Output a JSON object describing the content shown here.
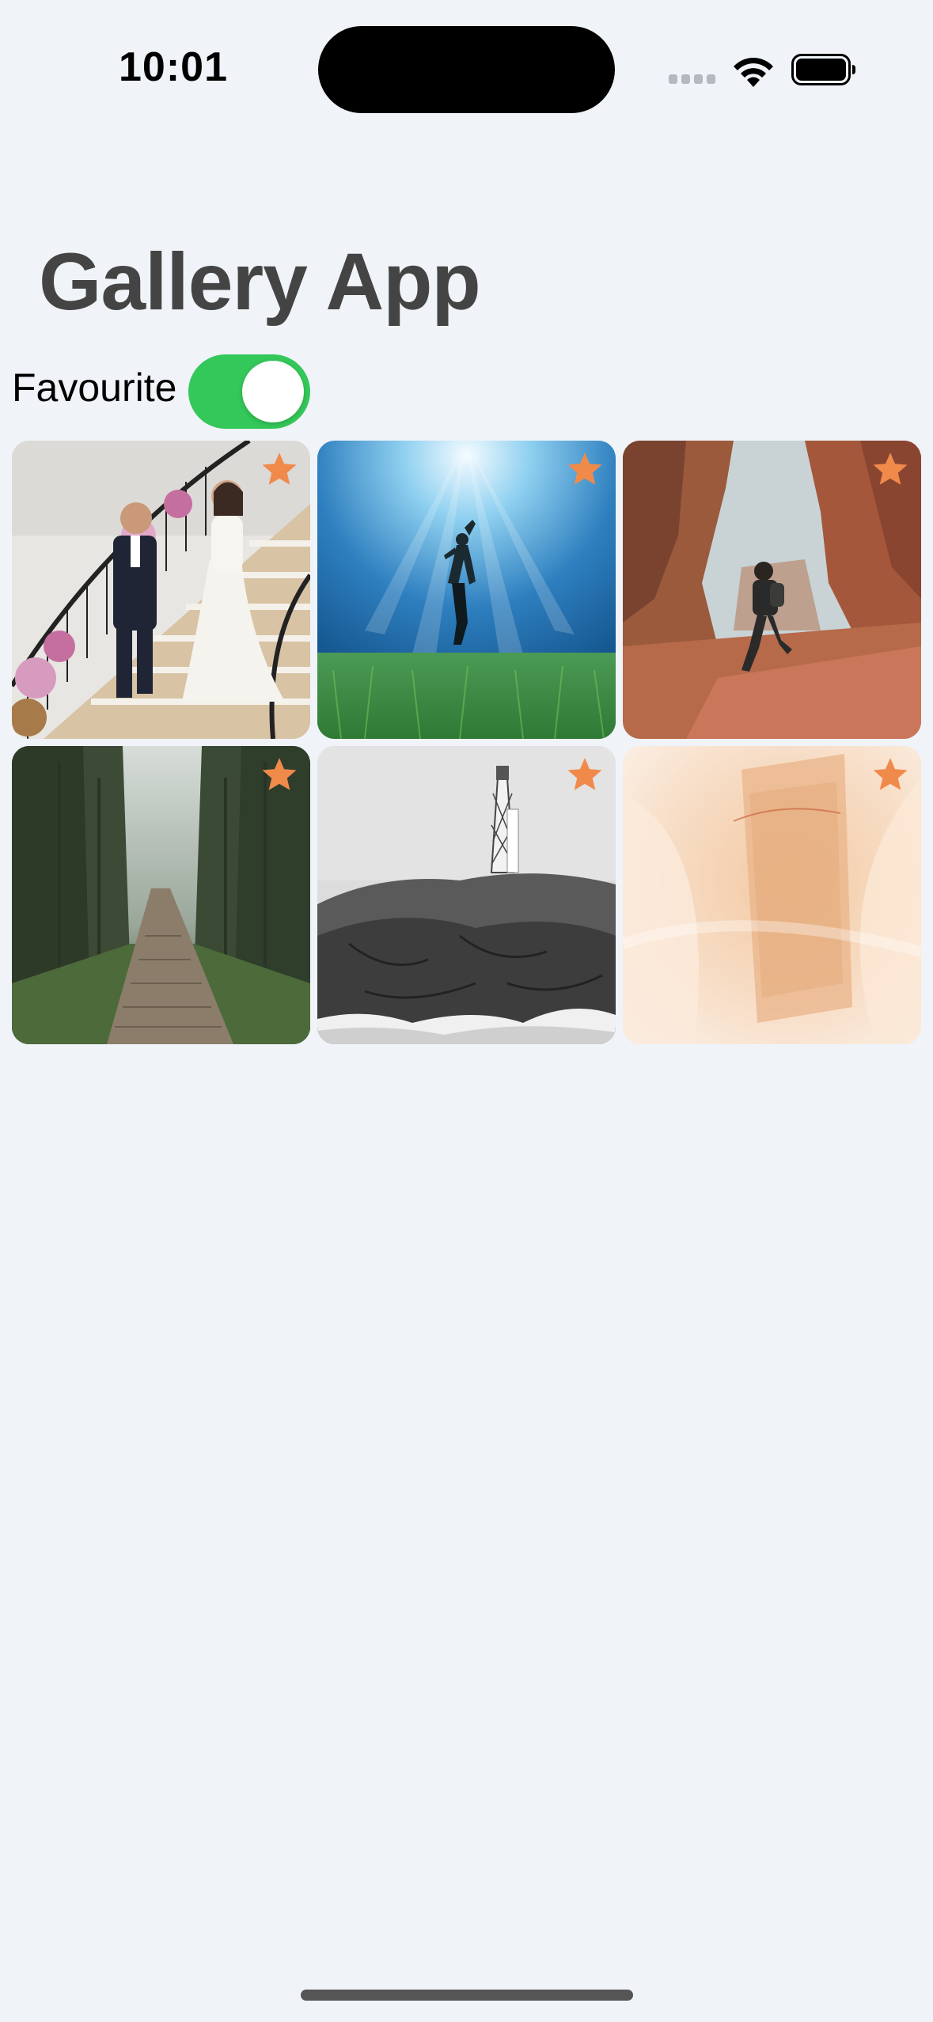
{
  "status_bar": {
    "time": "10:01"
  },
  "header": {
    "title": "Gallery App"
  },
  "filter": {
    "favourite_label": "Favourite",
    "favourite_on": true
  },
  "colors": {
    "accent_star": "#f08a4b",
    "toggle_on": "#34c759",
    "background": "#f0f3f8",
    "title_text": "#444444"
  },
  "photos": [
    {
      "subject": "wedding couple on staircase",
      "favourite": true
    },
    {
      "subject": "freediver underwater",
      "favourite": true
    },
    {
      "subject": "hiker in red canyon",
      "favourite": true
    },
    {
      "subject": "foggy forest boardwalk",
      "favourite": true
    },
    {
      "subject": "lighthouse on rocky shore",
      "favourite": true
    },
    {
      "subject": "peach fabric with embroidered text",
      "favourite": true
    }
  ]
}
